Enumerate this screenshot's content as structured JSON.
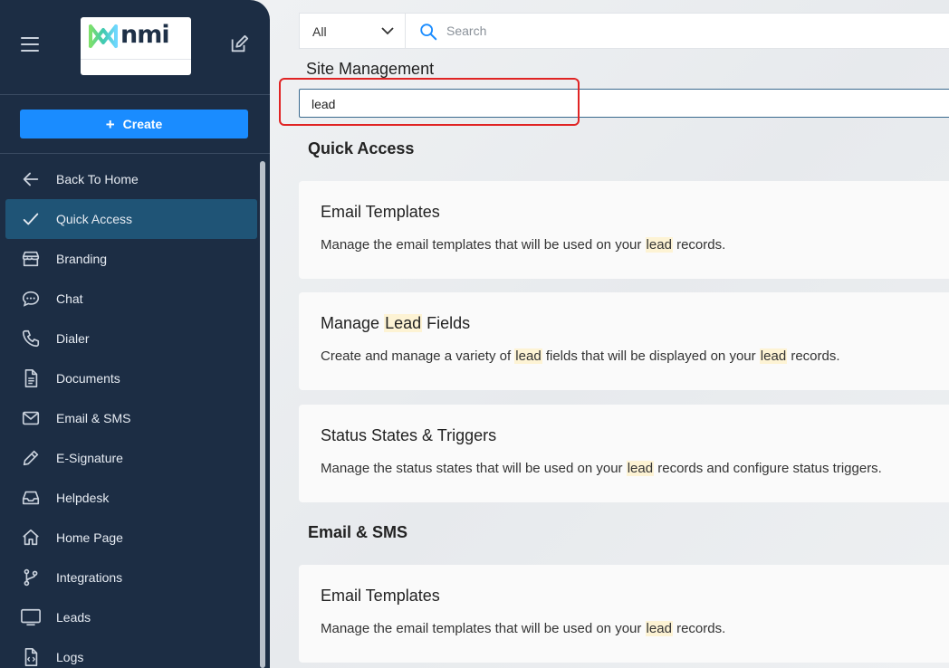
{
  "sidebar": {
    "logo_text": "nmi",
    "create_label": "Create",
    "items": [
      {
        "label": "Back To Home",
        "icon": "arrow-left-icon"
      },
      {
        "label": "Quick Access",
        "icon": "check-icon"
      },
      {
        "label": "Branding",
        "icon": "store-icon"
      },
      {
        "label": "Chat",
        "icon": "chat-bubble-icon"
      },
      {
        "label": "Dialer",
        "icon": "phone-icon"
      },
      {
        "label": "Documents",
        "icon": "document-icon"
      },
      {
        "label": "Email & SMS",
        "icon": "envelope-icon"
      },
      {
        "label": "E-Signature",
        "icon": "pen-icon"
      },
      {
        "label": "Helpdesk",
        "icon": "inbox-icon"
      },
      {
        "label": "Home Page",
        "icon": "home-icon"
      },
      {
        "label": "Integrations",
        "icon": "branch-icon"
      },
      {
        "label": "Leads",
        "icon": "monitor-icon"
      },
      {
        "label": "Logs",
        "icon": "code-file-icon"
      }
    ],
    "active_index": 1
  },
  "header": {
    "filter_value": "All",
    "search_placeholder": "Search"
  },
  "main": {
    "page_title": "Site Management",
    "filter_value": "lead",
    "sections": [
      {
        "title": "Quick Access",
        "cards": [
          {
            "title_pre": "Email Templates",
            "title_hl": "",
            "title_post": "",
            "desc_pre": "Manage the email templates that will be used on your ",
            "desc_hl": "lead",
            "desc_post": " records."
          },
          {
            "title_pre": "Manage ",
            "title_hl": "Lead",
            "title_post": " Fields",
            "desc_pre": "Create and manage a variety of ",
            "desc_hl": "lead",
            "desc_mid": " fields that will be displayed on your ",
            "desc_hl2": "lead",
            "desc_post": " records."
          },
          {
            "title_pre": "Status States & Triggers",
            "title_hl": "",
            "title_post": "",
            "desc_pre": "Manage the status states that will be used on your ",
            "desc_hl": "lead",
            "desc_post": " records and configure status triggers."
          }
        ]
      },
      {
        "title": "Email & SMS",
        "cards": [
          {
            "title_pre": "Email Templates",
            "title_hl": "",
            "title_post": "",
            "desc_pre": "Manage the email templates that will be used on your ",
            "desc_hl": "lead",
            "desc_post": " records."
          }
        ]
      }
    ]
  },
  "colors": {
    "sidebar_bg": "#1c2d44",
    "active_item": "#1f5476",
    "accent": "#1a8cff",
    "highlight": "#fdf3d4",
    "annotation_red": "#e02424"
  }
}
